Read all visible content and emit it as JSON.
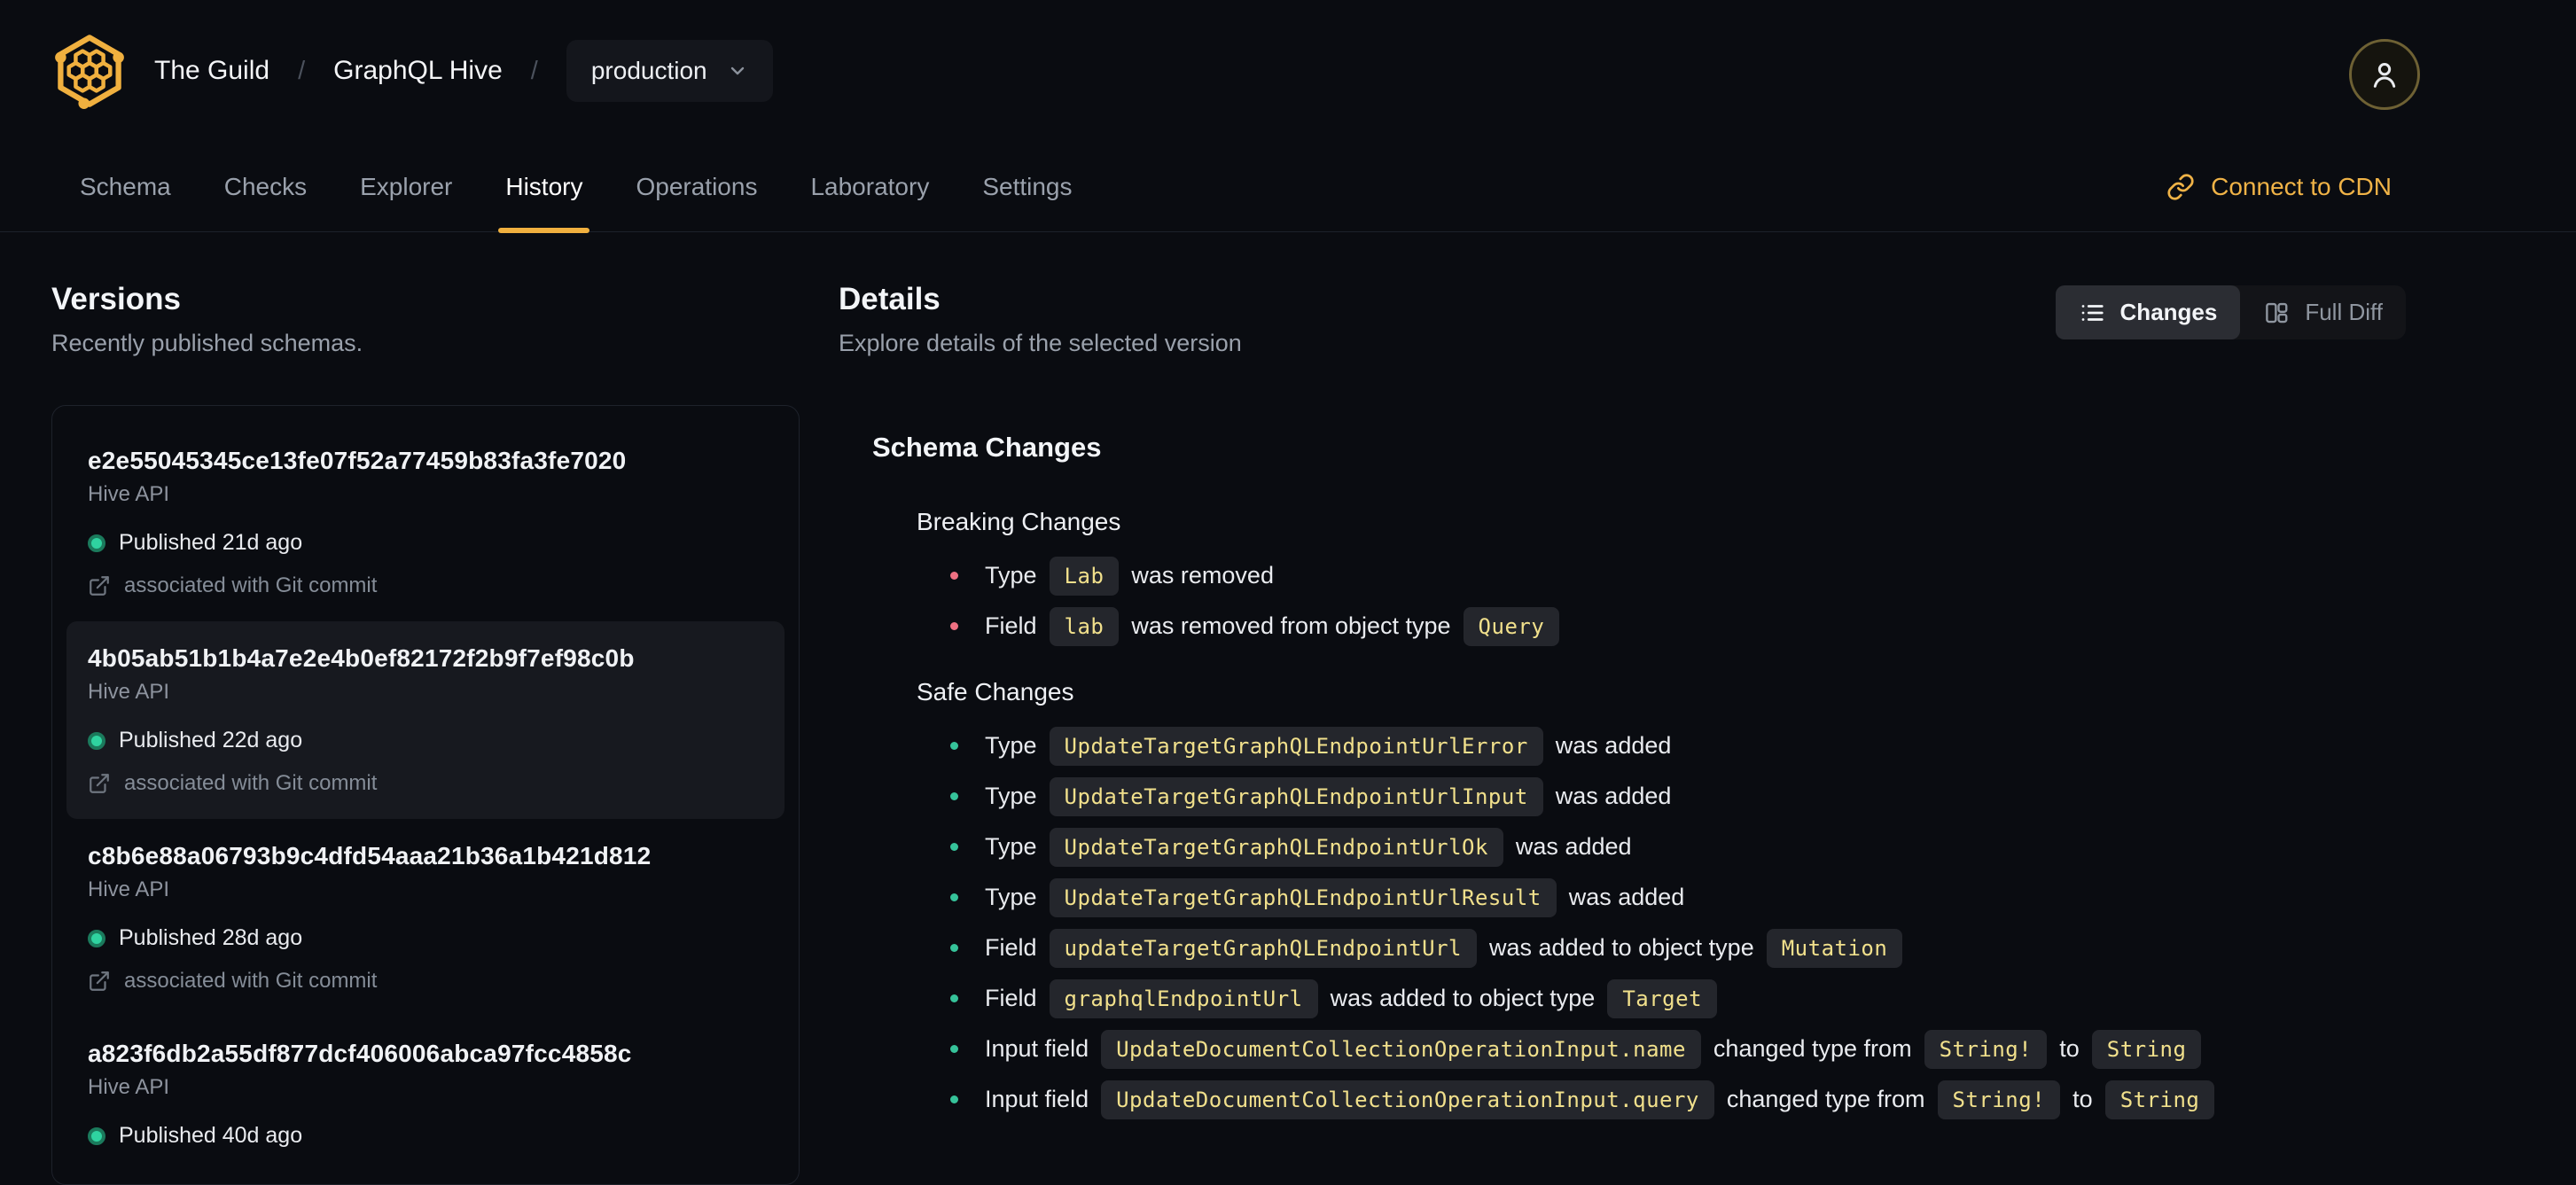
{
  "header": {
    "org": "The Guild",
    "separator": "/",
    "project": "GraphQL Hive",
    "target_selector": "production",
    "connect_cdn": "Connect to CDN"
  },
  "nav": {
    "tabs": [
      "Schema",
      "Checks",
      "Explorer",
      "History",
      "Operations",
      "Laboratory",
      "Settings"
    ],
    "active_tab": "History"
  },
  "versions": {
    "title": "Versions",
    "subtitle": "Recently published schemas.",
    "items": [
      {
        "hash": "e2e55045345ce13fe07f52a77459b83fa3fe7020",
        "service": "Hive API",
        "published": "Published 21d ago",
        "git": "associated with Git commit",
        "selected": false
      },
      {
        "hash": "4b05ab51b1b4a7e2e4b0ef82172f2b9f7ef98c0b",
        "service": "Hive API",
        "published": "Published 22d ago",
        "git": "associated with Git commit",
        "selected": true
      },
      {
        "hash": "c8b6e88a06793b9c4dfd54aaa21b36a1b421d812",
        "service": "Hive API",
        "published": "Published 28d ago",
        "git": "associated with Git commit",
        "selected": false
      },
      {
        "hash": "a823f6db2a55df877dcf406006abca97fcc4858c",
        "service": "Hive API",
        "published": "Published 40d ago",
        "git": null,
        "selected": false
      }
    ]
  },
  "details": {
    "title": "Details",
    "subtitle": "Explore details of the selected version",
    "view_toggle": {
      "changes": "Changes",
      "full_diff": "Full Diff",
      "active": "Changes"
    },
    "schema_changes": {
      "title": "Schema Changes",
      "groups": [
        {
          "title": "Breaking Changes",
          "severity": "breaking",
          "items": [
            [
              {
                "t": "text",
                "v": "Type"
              },
              {
                "t": "code",
                "v": "Lab"
              },
              {
                "t": "text",
                "v": "was removed"
              }
            ],
            [
              {
                "t": "text",
                "v": "Field"
              },
              {
                "t": "code",
                "v": "lab"
              },
              {
                "t": "text",
                "v": "was removed from object type"
              },
              {
                "t": "code",
                "v": "Query"
              }
            ]
          ]
        },
        {
          "title": "Safe Changes",
          "severity": "safe",
          "items": [
            [
              {
                "t": "text",
                "v": "Type"
              },
              {
                "t": "code",
                "v": "UpdateTargetGraphQLEndpointUrlError"
              },
              {
                "t": "text",
                "v": "was added"
              }
            ],
            [
              {
                "t": "text",
                "v": "Type"
              },
              {
                "t": "code",
                "v": "UpdateTargetGraphQLEndpointUrlInput"
              },
              {
                "t": "text",
                "v": "was added"
              }
            ],
            [
              {
                "t": "text",
                "v": "Type"
              },
              {
                "t": "code",
                "v": "UpdateTargetGraphQLEndpointUrlOk"
              },
              {
                "t": "text",
                "v": "was added"
              }
            ],
            [
              {
                "t": "text",
                "v": "Type"
              },
              {
                "t": "code",
                "v": "UpdateTargetGraphQLEndpointUrlResult"
              },
              {
                "t": "text",
                "v": "was added"
              }
            ],
            [
              {
                "t": "text",
                "v": "Field"
              },
              {
                "t": "code",
                "v": "updateTargetGraphQLEndpointUrl"
              },
              {
                "t": "text",
                "v": "was added to object type"
              },
              {
                "t": "code",
                "v": "Mutation"
              }
            ],
            [
              {
                "t": "text",
                "v": "Field"
              },
              {
                "t": "code",
                "v": "graphqlEndpointUrl"
              },
              {
                "t": "text",
                "v": "was added to object type"
              },
              {
                "t": "code",
                "v": "Target"
              }
            ],
            [
              {
                "t": "text",
                "v": "Input field"
              },
              {
                "t": "code",
                "v": "UpdateDocumentCollectionOperationInput.name"
              },
              {
                "t": "text",
                "v": "changed type from"
              },
              {
                "t": "code",
                "v": "String!"
              },
              {
                "t": "text",
                "v": "to"
              },
              {
                "t": "code",
                "v": "String"
              }
            ],
            [
              {
                "t": "text",
                "v": "Input field"
              },
              {
                "t": "code",
                "v": "UpdateDocumentCollectionOperationInput.query"
              },
              {
                "t": "text",
                "v": "changed type from"
              },
              {
                "t": "code",
                "v": "String!"
              },
              {
                "t": "text",
                "v": "to"
              },
              {
                "t": "code",
                "v": "String"
              }
            ]
          ]
        }
      ]
    }
  },
  "icons": {
    "logo": "hive-hexagon-logo",
    "target_selector": "chevron-down-icon",
    "avatar": "user-icon",
    "connect_cdn": "link-icon",
    "git": "external-link-icon",
    "changes": "list-icon",
    "full_diff": "split-panels-icon"
  },
  "colors": {
    "background": "#0a0c11",
    "accent": "#f0b03f",
    "breaking_bullet": "#ee7082",
    "safe_bullet": "#36c39a",
    "published_dot": "#2fd3a0",
    "code_text": "#f1e08c",
    "code_bg": "#24262c"
  }
}
